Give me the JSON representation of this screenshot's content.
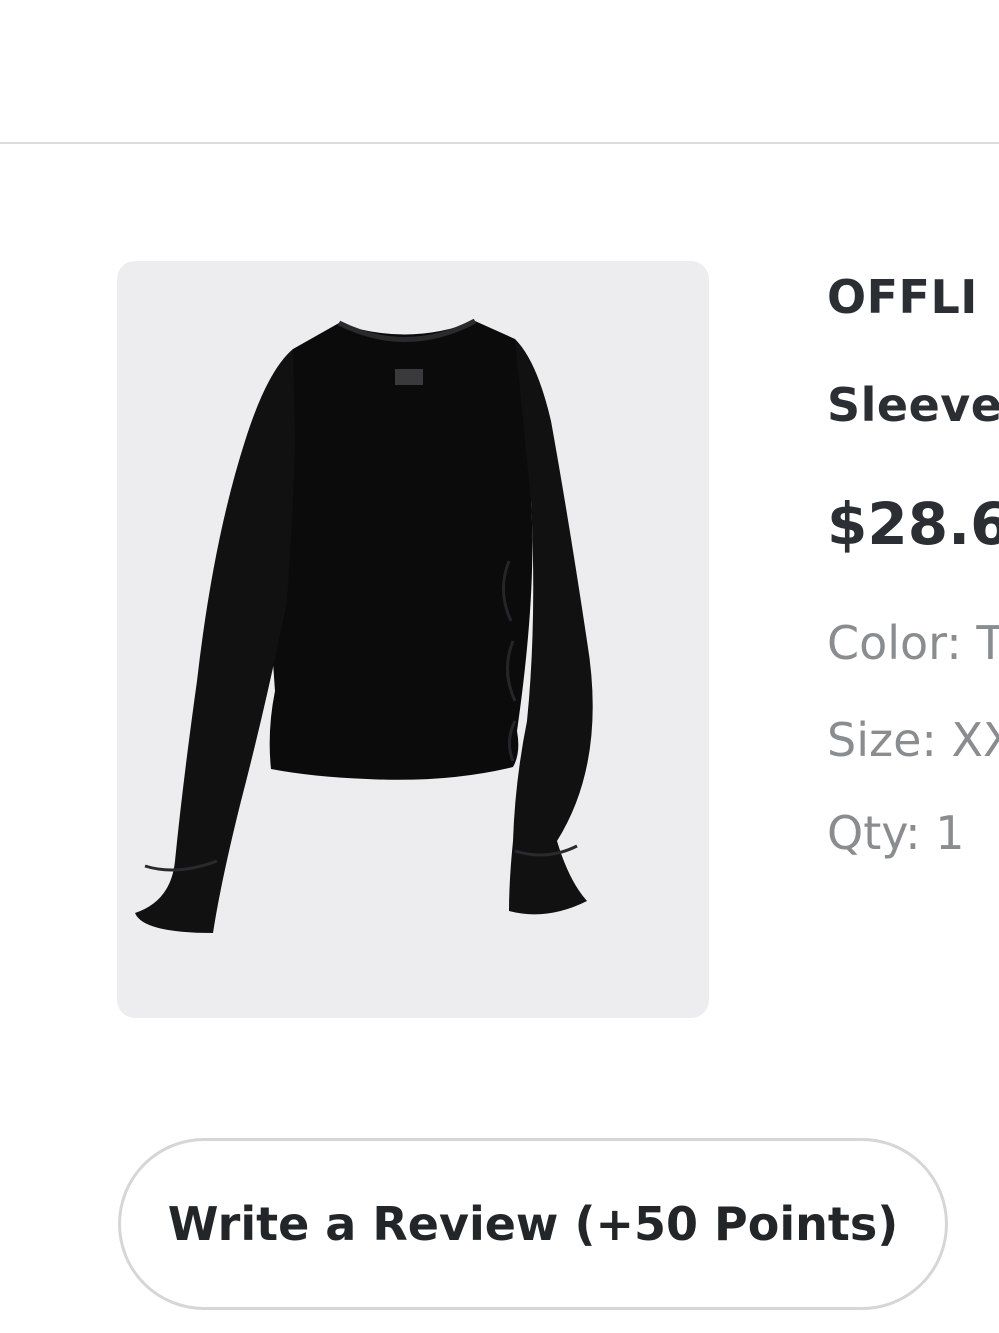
{
  "product": {
    "title_line1": "OFFLI",
    "title_line2": "Sleeve",
    "price": "$28.6",
    "color_text": "Color: T",
    "size_text": "Size: XX",
    "qty_text": "Qty: 1",
    "image_icon": "long-sleeve-shirt-image"
  },
  "actions": {
    "review_label": "Write a Review (+50 Points)"
  },
  "colors": {
    "image_bg": "#ededef",
    "text_dark": "#2b2f33",
    "text_muted": "#8a8d90",
    "border": "#d6d6d6"
  }
}
